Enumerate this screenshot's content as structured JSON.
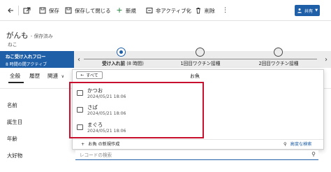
{
  "toolbar": {
    "back_icon": "back-arrow-icon",
    "popout_icon": "popout-icon",
    "save_label": "保存",
    "save_close_label": "保存して閉じる",
    "new_label": "新規",
    "deactivate_label": "非アクティブ化",
    "delete_label": "削除",
    "more_icon": "more-icon",
    "share_label": "共有"
  },
  "record": {
    "title": "がんも",
    "saved_status": "- 保存済み",
    "entity": "ねこ"
  },
  "bpf": {
    "active_stage_name": "ねこ受け入れフロー",
    "active_stage_duration": "8 時間の間アクティブ",
    "stages": [
      {
        "label": "受け入れ前",
        "duration": "(8 時間)"
      },
      {
        "label": "1回目ワクチン接種"
      },
      {
        "label": "2回目ワクチン接種"
      }
    ]
  },
  "tabs": [
    "全般",
    "履歴",
    "関連"
  ],
  "form": {
    "labels": [
      "名前",
      "誕生日",
      "年齢",
      "大好物"
    ]
  },
  "lookup_dropdown": {
    "back_label": "すべて",
    "header": "お魚",
    "items": [
      {
        "name": "かつお",
        "date": "2024/05/21 18:06"
      },
      {
        "name": "さば",
        "date": "2024/05/21 18:06"
      },
      {
        "name": "まぐろ",
        "date": "2024/05/21 18:06"
      }
    ],
    "new_label": "お魚 の新規作成",
    "advanced_label": "高度な検索"
  },
  "lookup": {
    "placeholder": "レコードの検索"
  },
  "colors": {
    "accent": "#1f5fa8",
    "highlight_box": "#c8102e"
  }
}
